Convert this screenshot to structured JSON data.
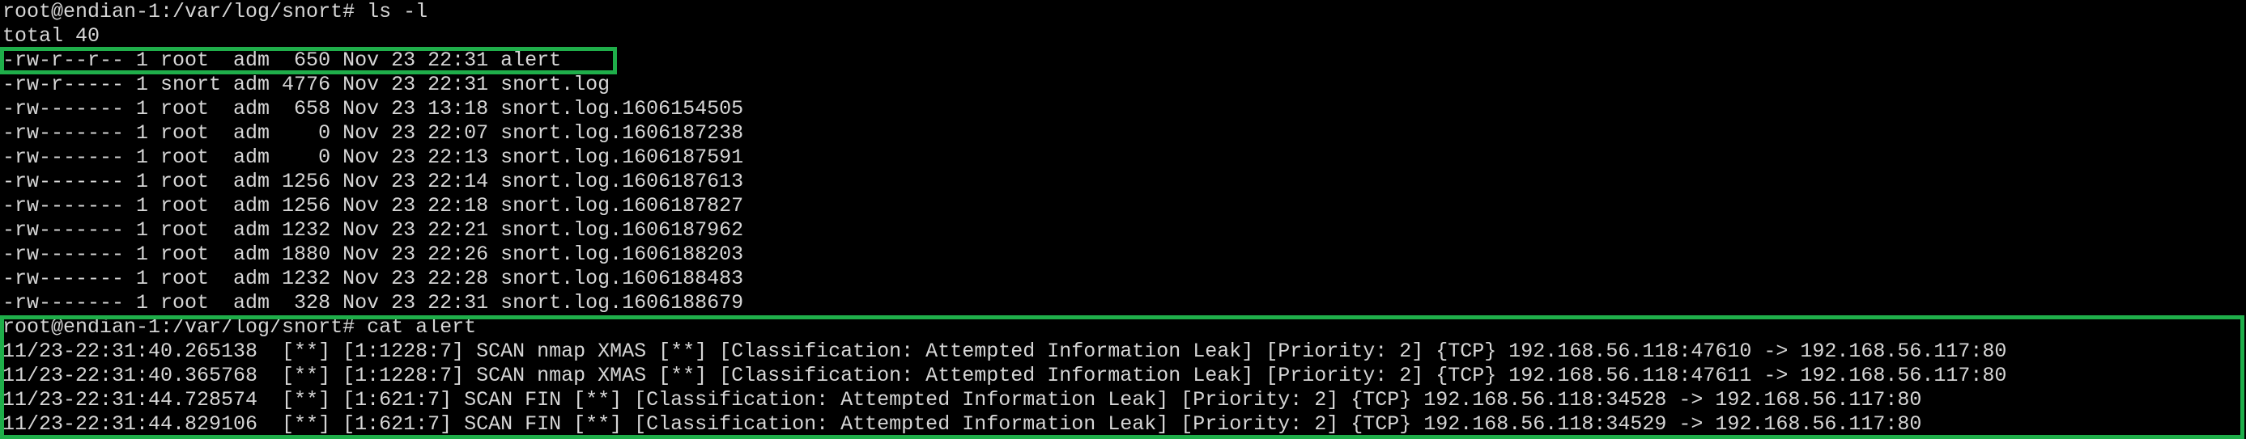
{
  "terminal": {
    "lines": [
      "root@endian-1:/var/log/snort# ls -l",
      "total 40",
      "-rw-r--r-- 1 root  adm  650 Nov 23 22:31 alert",
      "-rw-r----- 1 snort adm 4776 Nov 23 22:31 snort.log",
      "-rw------- 1 root  adm  658 Nov 23 13:18 snort.log.1606154505",
      "-rw------- 1 root  adm    0 Nov 23 22:07 snort.log.1606187238",
      "-rw------- 1 root  adm    0 Nov 23 22:13 snort.log.1606187591",
      "-rw------- 1 root  adm 1256 Nov 23 22:14 snort.log.1606187613",
      "-rw------- 1 root  adm 1256 Nov 23 22:18 snort.log.1606187827",
      "-rw------- 1 root  adm 1232 Nov 23 22:21 snort.log.1606187962",
      "-rw------- 1 root  adm 1880 Nov 23 22:26 snort.log.1606188203",
      "-rw------- 1 root  adm 1232 Nov 23 22:28 snort.log.1606188483",
      "-rw------- 1 root  adm  328 Nov 23 22:31 snort.log.1606188679",
      "root@endian-1:/var/log/snort# cat alert",
      "11/23-22:31:40.265138  [**] [1:1228:7] SCAN nmap XMAS [**] [Classification: Attempted Information Leak] [Priority: 2] {TCP} 192.168.56.118:47610 -> 192.168.56.117:80",
      "11/23-22:31:40.365768  [**] [1:1228:7] SCAN nmap XMAS [**] [Classification: Attempted Information Leak] [Priority: 2] {TCP} 192.168.56.118:47611 -> 192.168.56.117:80",
      "11/23-22:31:44.728574  [**] [1:621:7] SCAN FIN [**] [Classification: Attempted Information Leak] [Priority: 2] {TCP} 192.168.56.118:34528 -> 192.168.56.117:80",
      "11/23-22:31:44.829106  [**] [1:621:7] SCAN FIN [**] [Classification: Attempted Information Leak] [Priority: 2] {TCP} 192.168.56.118:34529 -> 192.168.56.117:80"
    ]
  },
  "colors": {
    "background": "#000000",
    "text": "#d6d6d6",
    "highlight": "#1fae4a"
  }
}
